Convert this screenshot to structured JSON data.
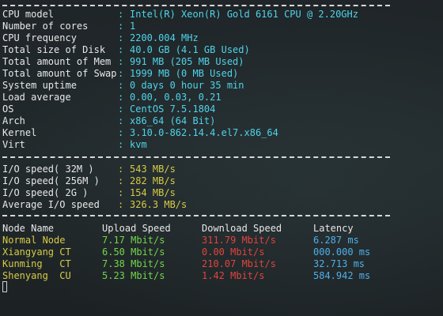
{
  "system_info": [
    {
      "label": "CPU model",
      "value": "Intel(R) Xeon(R) Gold 6161 CPU @ 2.20GHz"
    },
    {
      "label": "Number of cores",
      "value": "1"
    },
    {
      "label": "CPU frequency",
      "value": "2200.004 MHz"
    },
    {
      "label": "Total size of Disk",
      "value": "40.0 GB (4.1 GB Used)"
    },
    {
      "label": "Total amount of Mem",
      "value": "991 MB (205 MB Used)"
    },
    {
      "label": "Total amount of Swap",
      "value": "1999 MB (0 MB Used)"
    },
    {
      "label": "System uptime",
      "value": "0 days 0 hour 35 min"
    },
    {
      "label": "Load average",
      "value": "0.00, 0.03, 0.21"
    },
    {
      "label": "OS",
      "value": "CentOS 7.5.1804"
    },
    {
      "label": "Arch",
      "value": "x86_64 (64 Bit)"
    },
    {
      "label": "Kernel",
      "value": "3.10.0-862.14.4.el7.x86_64"
    },
    {
      "label": "Virt",
      "value": "kvm"
    }
  ],
  "io_tests": [
    {
      "label": "I/O speed( 32M )",
      "value": "543 MB/s"
    },
    {
      "label": "I/O speed( 256M )",
      "value": "282 MB/s"
    },
    {
      "label": "I/O speed( 2G )",
      "value": "154 MB/s"
    },
    {
      "label": "Average I/O speed",
      "value": "326.3 MB/s"
    }
  ],
  "separator": ":",
  "speed_table": {
    "headers": {
      "node": "Node Name",
      "upload": "Upload Speed",
      "download": "Download Speed",
      "latency": "Latency"
    },
    "rows": [
      {
        "node": "Normal Node",
        "upload": "7.17 Mbit/s",
        "download": "311.79 Mbit/s",
        "latency": "6.287 ms"
      },
      {
        "node": "Xiangyang CT",
        "upload": "6.50 Mbit/s",
        "download": "0.00 Mbit/s",
        "latency": "000.000 ms"
      },
      {
        "node": "Kunming   CT",
        "upload": "7.38 Mbit/s",
        "download": "210.07 Mbit/s",
        "latency": "32.713 ms"
      },
      {
        "node": "Shenyang  CU",
        "upload": "5.23 Mbit/s",
        "download": "1.42 Mbit/s",
        "latency": "584.942 ms"
      }
    ]
  },
  "colors": {
    "label": "#e8e8e8",
    "system_value": "#4fd4ea",
    "io_value": "#d6cb46",
    "upload": "#72d64a",
    "download": "#e0443e",
    "latency": "#4fb0ea"
  }
}
